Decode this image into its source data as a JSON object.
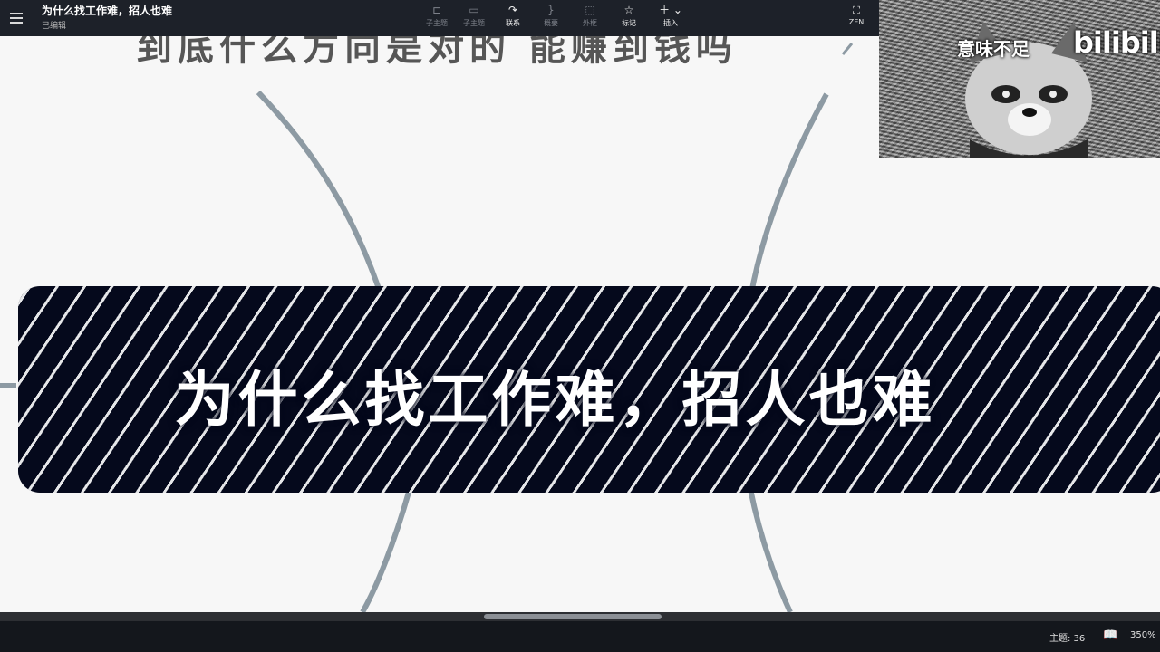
{
  "app": {
    "title": "为什么找工作难，招人也难",
    "status": "已编辑"
  },
  "toolbar": {
    "items": [
      {
        "label": "子主题",
        "icon": "subtopic-icon"
      },
      {
        "label": "子主题",
        "icon": "sibling-topic-icon"
      },
      {
        "label": "联系",
        "icon": "relationship-icon"
      },
      {
        "label": "概要",
        "icon": "summary-icon"
      },
      {
        "label": "外框",
        "icon": "boundary-icon"
      },
      {
        "label": "标记",
        "icon": "marker-star-icon"
      },
      {
        "label": "插入",
        "icon": "insert-plus-icon"
      }
    ],
    "zen_label": "ZEN"
  },
  "canvas": {
    "ghost_text": "到底什么方向是对的 能赚到钱吗",
    "banner_title": "为什么找工作难，招人也难",
    "connector_color": "#8d9aa3"
  },
  "webcam": {
    "caption": "意味不足",
    "logo": "bilibili"
  },
  "statusbar": {
    "topics": "主题: 36",
    "zoom": "350%"
  },
  "colors": {
    "toolbar_bg": "#1d2129",
    "banner_bg": "#05091c",
    "canvas_bg": "#f7f7f7"
  }
}
